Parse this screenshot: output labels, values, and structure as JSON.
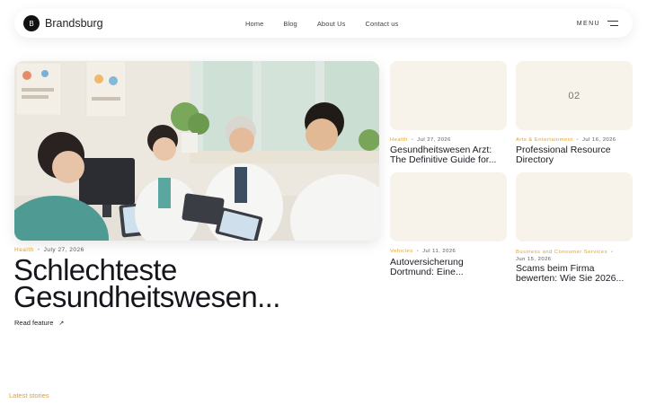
{
  "header": {
    "logo_letter": "B",
    "brand": "Brandsburg",
    "nav": [
      "Home",
      "Blog",
      "About Us",
      "Contact us"
    ],
    "menu_label": "MENU"
  },
  "feature": {
    "category": "Health",
    "date": "July 27, 2026",
    "title_line1": "Schlechteste",
    "title_line2": "Gesundheitswesen...",
    "read_label": "Read feature",
    "read_icon": "arrow-up-right-icon"
  },
  "cards": [
    {
      "number": "",
      "category": "Health",
      "date": "Jul 27, 2026",
      "title_line1": "Gesundheitswesen Arzt:",
      "title_line2": "The Definitive Guide for..."
    },
    {
      "number": "02",
      "category": "Arts & Entertainment",
      "date": "Jul 16, 2026",
      "title_line1": "Professional Resource",
      "title_line2": "Directory"
    },
    {
      "number": "",
      "category": "Vehicles",
      "date": "Jul 11, 2026",
      "title_line1": "Autoversicherung",
      "title_line2": "Dortmund: Eine..."
    },
    {
      "number": "",
      "category": "Business and Consumer Services",
      "date": "Jun 15, 2026",
      "title_line1": "Scams beim Firma",
      "title_line2": "bewerten: Wie Sie 2026..."
    }
  ],
  "latest_label": "Latest stories",
  "colors": {
    "accent": "#e2a12a",
    "card_bg": "#f7f2ea",
    "text": "#1b1b22"
  }
}
